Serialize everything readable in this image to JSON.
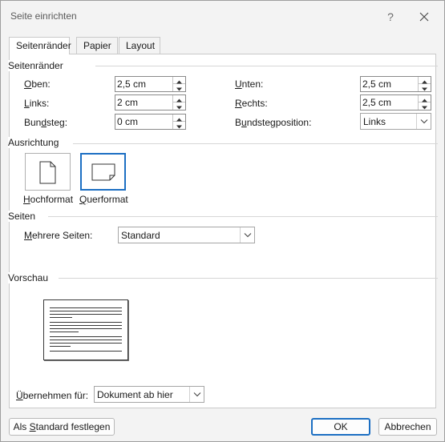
{
  "window": {
    "title": "Seite einrichten",
    "help": "?",
    "close_icon": "close-icon"
  },
  "tabs": [
    {
      "label": "Seitenränder",
      "active": true
    },
    {
      "label": "Papier",
      "active": false
    },
    {
      "label": "Layout",
      "active": false
    }
  ],
  "margins": {
    "heading": "Seitenränder",
    "top": {
      "label_u": "O",
      "label_rest": "ben:",
      "value": "2,5 cm"
    },
    "left": {
      "label_u": "L",
      "label_rest": "inks:",
      "value": "2 cm"
    },
    "gutter": {
      "label_a": "Bun",
      "label_u": "d",
      "label_rest": "steg:",
      "value": "0 cm"
    },
    "bottom": {
      "label_u": "U",
      "label_rest": "nten:",
      "value": "2,5 cm"
    },
    "right": {
      "label_u": "R",
      "label_rest": "echts:",
      "value": "2,5 cm"
    },
    "gutter_position": {
      "label_a": "B",
      "label_u": "u",
      "label_rest": "ndstegposition:",
      "value": "Links"
    }
  },
  "orientation": {
    "heading": "Ausrichtung",
    "portrait": {
      "label_u": "H",
      "label_rest": "ochformat"
    },
    "landscape": {
      "label_u": "Q",
      "label_rest": "uerformat",
      "selected": true
    }
  },
  "pages": {
    "heading": "Seiten",
    "multiple": {
      "label_u": "M",
      "label_rest": "ehrere Seiten:",
      "value": "Standard"
    }
  },
  "preview": {
    "heading": "Vorschau"
  },
  "apply": {
    "label_u": "Ü",
    "label_rest": "bernehmen für:",
    "value": "Dokument ab hier"
  },
  "buttons": {
    "default": {
      "label_a": "Als ",
      "label_u": "S",
      "label_rest": "tandard festlegen"
    },
    "ok": "OK",
    "cancel": "Abbrechen"
  },
  "colors": {
    "accent": "#1c6fc3",
    "dialog_bg": "#f3f3f3",
    "panel_bg": "#ffffff"
  }
}
